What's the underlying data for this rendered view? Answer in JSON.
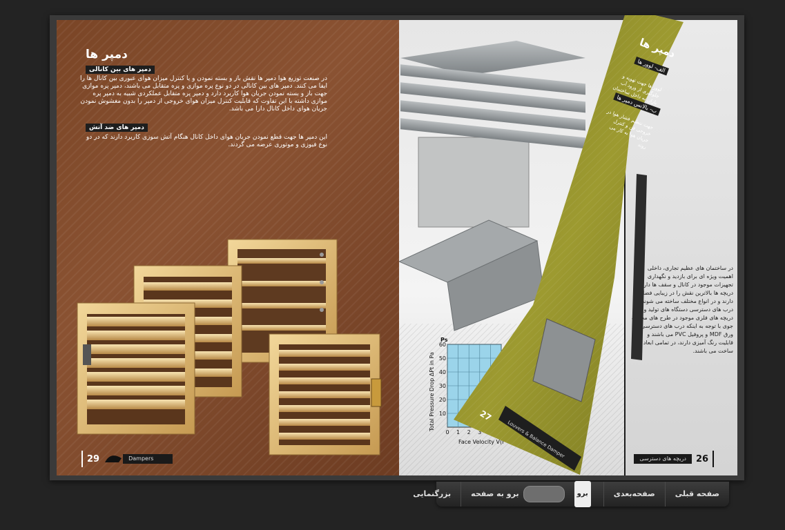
{
  "left_page": {
    "title": "دمپر ها",
    "section1_title": "دمپر های بین کانالی",
    "section1_text": "در صنعت توزیع هوا دمپر ها نقش باز و بسته نمودن و یا کنترل میزان هوای عبوری بین کانال ها را ایفا می کنند. دمپر های بین کانالی در دو نوع پره موازی و پره متقابل می باشند، دمپر پره موازی جهت باز و بسته نمودن جریان هوا کاربرد دارد و دمپر پره متقابل عملکردی شبیه به دمپر پره موازی داشته با این تفاوت که قابلیت کنترل میزان هوای خروجی از دمپر را بدون مغشوش نمودن جریان هوای داخل کانال دارا می باشد.",
    "section2_title": "دمپر های ضد آتش",
    "section2_text": "این دمپر ها جهت قطع نمودن جریان هوای داخل کانال هنگام آتش سوزی کاربرد دارند که در دو نوع فیوزی و موتوری عرضه می گردند.",
    "page_number": "29",
    "footer_label": "Dampers"
  },
  "right_page": {
    "chart_title_abbrev": "Ps",
    "chart_xlabel": "Face Velocity V(m",
    "chart_ylabel": "Total Pressure Drop ΔPt in Pa",
    "page_number": "26",
    "footer_label": "دریچه های دسترسی",
    "side_text": "در ساختمان های عظیم تجاری، داخلی اهمیت ویژه ای برای بازدید و نگهداری تجهیزات موجود در کانال و سقف ها دارد. دریچه ها بالاترین نقش را در زیبایی فضا دارند و در انواع مختلف ساخته می شوند. درب های دسترسی دستگاه های تولید و دریچه های فلزی موجود در طرح های مختلف جوی با توجه به اینکه درب های دسترسی از ورق MDF و پروفیل PVC می باشند و قابلیت رنگ آمیزی دارند، در تمامی ابعاد قابل ساخت می باشند."
  },
  "chart_data": {
    "type": "line",
    "title": "Ps",
    "xlabel": "Face Velocity V(m",
    "ylabel": "Total Pressure Drop ΔPt in Pa",
    "x_ticks": [
      "0",
      "1",
      "2",
      "3",
      "4",
      "5"
    ],
    "y_ticks": [
      "10",
      "20",
      "30",
      "40",
      "50",
      "60"
    ],
    "ylim": [
      0,
      60
    ],
    "grid": true
  },
  "turning_page": {
    "title": "دمپر ها",
    "sub1": "الف- لوور ها",
    "text1": "لوور ها جهت تهویه و جلوگیری از ورود آب باران به داخل ساختمان استفاده می شوند",
    "sub2": "ب- بالانس دمپر ها",
    "text2": "جهت تنظیم فشار هوا در خروجی فن و کنترل جریان هوا به کار می روند",
    "page_number": "27",
    "footer_label": "Louvers & Balance Damper"
  },
  "toolbar": {
    "prev_label": "صفحه قبلی",
    "next_label": "صفحه‌بعدی",
    "goto_label": "برو به صفحه",
    "goto_value": "",
    "go_label": "برو",
    "zoom_label": "بزرگنمایی"
  }
}
